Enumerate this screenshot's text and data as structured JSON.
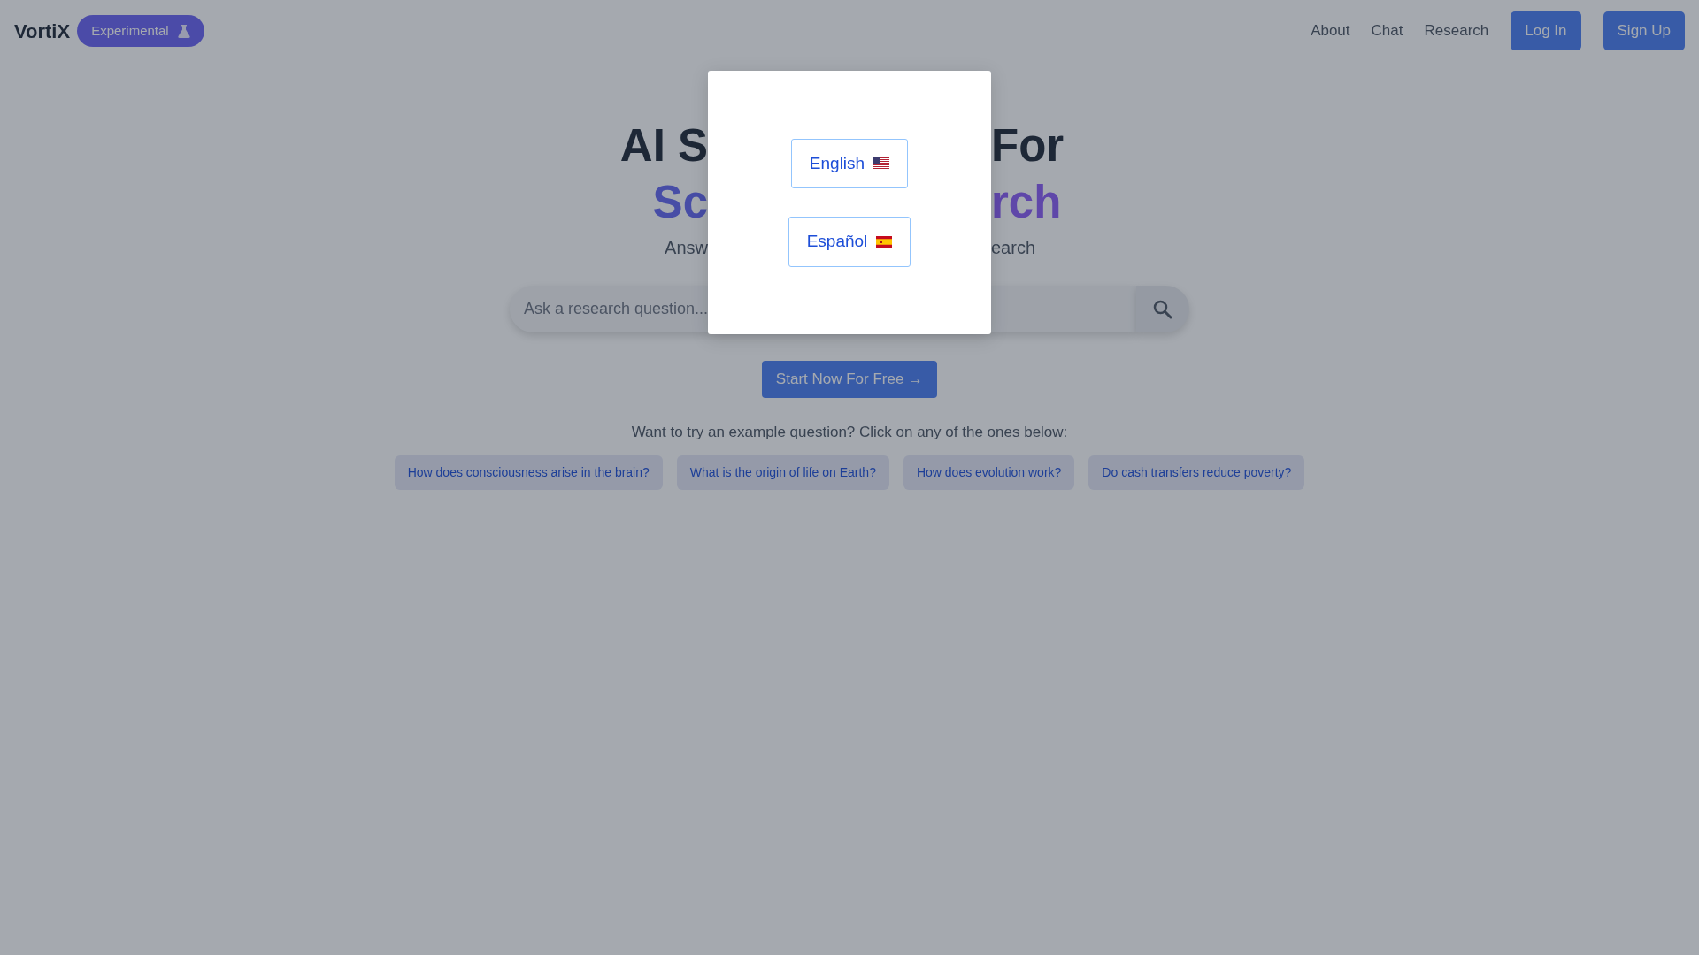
{
  "navbar": {
    "brand": "VortiX",
    "badge": "Experimental",
    "links": [
      "About",
      "Chat",
      "Research"
    ],
    "buttons": [
      "Log In",
      "Sign Up"
    ]
  },
  "hero": {
    "title_lines": [
      {
        "left": "AI S",
        "right": "For",
        "kind": "plain"
      },
      {
        "left": "Sc",
        "right": "rch",
        "kind": "accent"
      }
    ],
    "subtitle": {
      "left": "Answ",
      "right": "earch"
    }
  },
  "search": {
    "placeholder": "Ask a research question..."
  },
  "cta": "Start Now For Free →",
  "examples": {
    "prompt": "Want to try an example question? Click on any of the ones below:",
    "items": [
      "How does consciousness arise in the brain?",
      "What is the origin of life on Earth?",
      "How does evolution work?",
      "Do cash transfers reduce poverty?"
    ]
  },
  "language_modal": {
    "options": [
      "English",
      "Español"
    ]
  }
}
